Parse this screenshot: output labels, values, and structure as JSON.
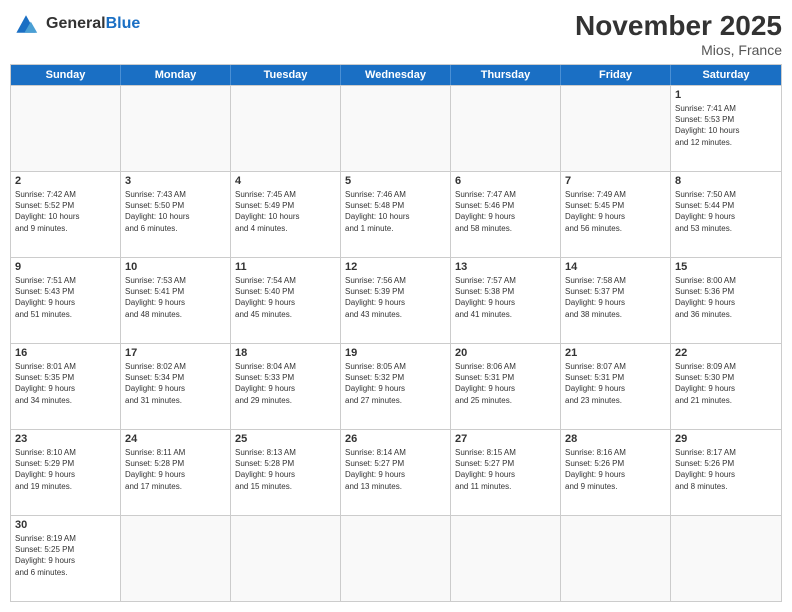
{
  "header": {
    "logo_general": "General",
    "logo_blue": "Blue",
    "month_title": "November 2025",
    "location": "Mios, France"
  },
  "day_headers": [
    "Sunday",
    "Monday",
    "Tuesday",
    "Wednesday",
    "Thursday",
    "Friday",
    "Saturday"
  ],
  "weeks": [
    {
      "days": [
        {
          "number": "",
          "info": "",
          "empty": true
        },
        {
          "number": "",
          "info": "",
          "empty": true
        },
        {
          "number": "",
          "info": "",
          "empty": true
        },
        {
          "number": "",
          "info": "",
          "empty": true
        },
        {
          "number": "",
          "info": "",
          "empty": true
        },
        {
          "number": "",
          "info": "",
          "empty": true
        },
        {
          "number": "1",
          "info": "Sunrise: 7:41 AM\nSunset: 5:53 PM\nDaylight: 10 hours\nand 12 minutes.",
          "empty": false
        }
      ]
    },
    {
      "days": [
        {
          "number": "2",
          "info": "Sunrise: 7:42 AM\nSunset: 5:52 PM\nDaylight: 10 hours\nand 9 minutes.",
          "empty": false
        },
        {
          "number": "3",
          "info": "Sunrise: 7:43 AM\nSunset: 5:50 PM\nDaylight: 10 hours\nand 6 minutes.",
          "empty": false
        },
        {
          "number": "4",
          "info": "Sunrise: 7:45 AM\nSunset: 5:49 PM\nDaylight: 10 hours\nand 4 minutes.",
          "empty": false
        },
        {
          "number": "5",
          "info": "Sunrise: 7:46 AM\nSunset: 5:48 PM\nDaylight: 10 hours\nand 1 minute.",
          "empty": false
        },
        {
          "number": "6",
          "info": "Sunrise: 7:47 AM\nSunset: 5:46 PM\nDaylight: 9 hours\nand 58 minutes.",
          "empty": false
        },
        {
          "number": "7",
          "info": "Sunrise: 7:49 AM\nSunset: 5:45 PM\nDaylight: 9 hours\nand 56 minutes.",
          "empty": false
        },
        {
          "number": "8",
          "info": "Sunrise: 7:50 AM\nSunset: 5:44 PM\nDaylight: 9 hours\nand 53 minutes.",
          "empty": false
        }
      ]
    },
    {
      "days": [
        {
          "number": "9",
          "info": "Sunrise: 7:51 AM\nSunset: 5:43 PM\nDaylight: 9 hours\nand 51 minutes.",
          "empty": false
        },
        {
          "number": "10",
          "info": "Sunrise: 7:53 AM\nSunset: 5:41 PM\nDaylight: 9 hours\nand 48 minutes.",
          "empty": false
        },
        {
          "number": "11",
          "info": "Sunrise: 7:54 AM\nSunset: 5:40 PM\nDaylight: 9 hours\nand 45 minutes.",
          "empty": false
        },
        {
          "number": "12",
          "info": "Sunrise: 7:56 AM\nSunset: 5:39 PM\nDaylight: 9 hours\nand 43 minutes.",
          "empty": false
        },
        {
          "number": "13",
          "info": "Sunrise: 7:57 AM\nSunset: 5:38 PM\nDaylight: 9 hours\nand 41 minutes.",
          "empty": false
        },
        {
          "number": "14",
          "info": "Sunrise: 7:58 AM\nSunset: 5:37 PM\nDaylight: 9 hours\nand 38 minutes.",
          "empty": false
        },
        {
          "number": "15",
          "info": "Sunrise: 8:00 AM\nSunset: 5:36 PM\nDaylight: 9 hours\nand 36 minutes.",
          "empty": false
        }
      ]
    },
    {
      "days": [
        {
          "number": "16",
          "info": "Sunrise: 8:01 AM\nSunset: 5:35 PM\nDaylight: 9 hours\nand 34 minutes.",
          "empty": false
        },
        {
          "number": "17",
          "info": "Sunrise: 8:02 AM\nSunset: 5:34 PM\nDaylight: 9 hours\nand 31 minutes.",
          "empty": false
        },
        {
          "number": "18",
          "info": "Sunrise: 8:04 AM\nSunset: 5:33 PM\nDaylight: 9 hours\nand 29 minutes.",
          "empty": false
        },
        {
          "number": "19",
          "info": "Sunrise: 8:05 AM\nSunset: 5:32 PM\nDaylight: 9 hours\nand 27 minutes.",
          "empty": false
        },
        {
          "number": "20",
          "info": "Sunrise: 8:06 AM\nSunset: 5:31 PM\nDaylight: 9 hours\nand 25 minutes.",
          "empty": false
        },
        {
          "number": "21",
          "info": "Sunrise: 8:07 AM\nSunset: 5:31 PM\nDaylight: 9 hours\nand 23 minutes.",
          "empty": false
        },
        {
          "number": "22",
          "info": "Sunrise: 8:09 AM\nSunset: 5:30 PM\nDaylight: 9 hours\nand 21 minutes.",
          "empty": false
        }
      ]
    },
    {
      "days": [
        {
          "number": "23",
          "info": "Sunrise: 8:10 AM\nSunset: 5:29 PM\nDaylight: 9 hours\nand 19 minutes.",
          "empty": false
        },
        {
          "number": "24",
          "info": "Sunrise: 8:11 AM\nSunset: 5:28 PM\nDaylight: 9 hours\nand 17 minutes.",
          "empty": false
        },
        {
          "number": "25",
          "info": "Sunrise: 8:13 AM\nSunset: 5:28 PM\nDaylight: 9 hours\nand 15 minutes.",
          "empty": false
        },
        {
          "number": "26",
          "info": "Sunrise: 8:14 AM\nSunset: 5:27 PM\nDaylight: 9 hours\nand 13 minutes.",
          "empty": false
        },
        {
          "number": "27",
          "info": "Sunrise: 8:15 AM\nSunset: 5:27 PM\nDaylight: 9 hours\nand 11 minutes.",
          "empty": false
        },
        {
          "number": "28",
          "info": "Sunrise: 8:16 AM\nSunset: 5:26 PM\nDaylight: 9 hours\nand 9 minutes.",
          "empty": false
        },
        {
          "number": "29",
          "info": "Sunrise: 8:17 AM\nSunset: 5:26 PM\nDaylight: 9 hours\nand 8 minutes.",
          "empty": false
        }
      ]
    },
    {
      "days": [
        {
          "number": "30",
          "info": "Sunrise: 8:19 AM\nSunset: 5:25 PM\nDaylight: 9 hours\nand 6 minutes.",
          "empty": false
        },
        {
          "number": "",
          "info": "",
          "empty": true
        },
        {
          "number": "",
          "info": "",
          "empty": true
        },
        {
          "number": "",
          "info": "",
          "empty": true
        },
        {
          "number": "",
          "info": "",
          "empty": true
        },
        {
          "number": "",
          "info": "",
          "empty": true
        },
        {
          "number": "",
          "info": "",
          "empty": true
        }
      ]
    }
  ]
}
